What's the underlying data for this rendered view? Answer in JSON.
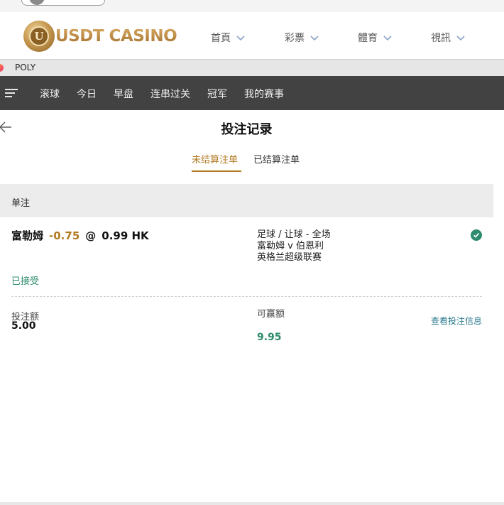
{
  "site": {
    "brand": "USDT CASINO",
    "logo_letter": "U",
    "nav": [
      {
        "label": "首頁"
      },
      {
        "label": "彩票"
      },
      {
        "label": "體育"
      },
      {
        "label": "視訊"
      }
    ]
  },
  "provider_bar": {
    "label": "POLY"
  },
  "sport_nav": {
    "tabs": [
      "滚球",
      "今日",
      "早盘",
      "连串过关",
      "冠军",
      "我的赛事"
    ]
  },
  "page": {
    "title": "投注记录",
    "tabs": [
      {
        "label": "未结算注单",
        "active": true
      },
      {
        "label": "已结算注单",
        "active": false
      }
    ]
  },
  "section": {
    "title": "单注"
  },
  "bet": {
    "team": "富勒姆",
    "handicap": "-0.75",
    "at": "@",
    "odds": "0.99 HK",
    "market_line1": "足球 / 让球 - 全场",
    "market_line2": "富勒姆 v 伯恩利",
    "market_line3": "英格兰超级联赛",
    "status": "已接受",
    "stake_label": "投注额",
    "stake_value": "5.00",
    "win_label": "可赢额",
    "win_value": "9.95",
    "view_info": "查看投注信息"
  },
  "colors": {
    "accent_gold": "#b27a22",
    "accent_green": "#2e8b6e",
    "nav_dark": "#424242",
    "link_teal": "#2a7a8c"
  },
  "icons": {
    "back": "arrow-left-icon",
    "menu": "hamburger-menu-icon",
    "status": "check-circle-icon",
    "nav_dropdown": "chevron-down-icon"
  }
}
